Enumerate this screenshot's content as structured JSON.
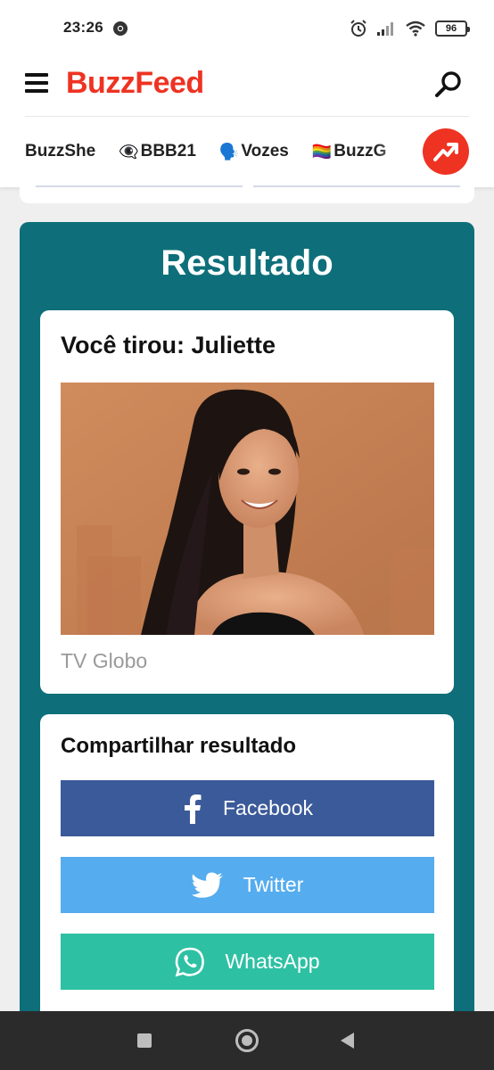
{
  "status_bar": {
    "time": "23:26",
    "battery": "96",
    "icons": [
      "chrome-icon",
      "alarm-icon",
      "signal-icon",
      "wifi-icon",
      "battery-icon"
    ]
  },
  "header": {
    "logo": "BuzzFeed",
    "brand_color": "#ee3322",
    "nav_items": [
      {
        "emoji": "",
        "label": "BuzzShe"
      },
      {
        "emoji": "👁️‍🗨️",
        "label": "BBB21"
      },
      {
        "emoji": "🗣️",
        "label": "Vozes"
      },
      {
        "emoji": "🏳️‍🌈",
        "label": "BuzzG"
      }
    ]
  },
  "result": {
    "title": "Resultado",
    "heading": "Você tirou: Juliette",
    "image_credit": "TV Globo",
    "panel_color": "#0e6f7a"
  },
  "share": {
    "heading": "Compartilhar resultado",
    "facebook_label": "Facebook",
    "twitter_label": "Twitter",
    "whatsapp_label": "WhatsApp",
    "colors": {
      "facebook": "#3b5a9a",
      "twitter": "#55acee",
      "whatsapp": "#2ec0a3"
    }
  }
}
